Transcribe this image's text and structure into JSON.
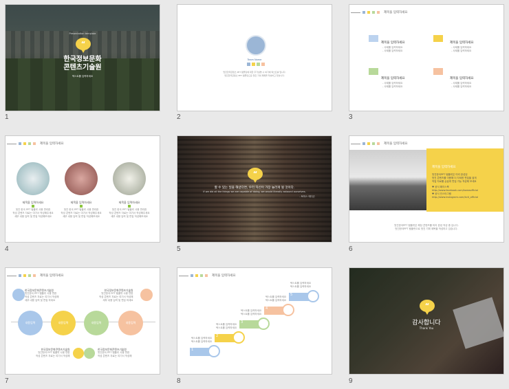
{
  "palette": {
    "yellow": "#f5d24a",
    "blue": "#a9c7ea",
    "green": "#b8d99a",
    "peach": "#f6c2a0",
    "gray": "#999999"
  },
  "slide_numbers": [
    "1",
    "2",
    "3",
    "4",
    "5",
    "6",
    "7",
    "8",
    "9"
  ],
  "common": {
    "header_title": "제목을 입력하세요",
    "quote_icon": "“"
  },
  "s1": {
    "small_title": "Presentation template",
    "title_line1": "한국정보문화",
    "title_line2": "콘텐츠기술원",
    "subtitle": "텍스트를 입력하세요"
  },
  "s2": {
    "team_name": "Team Name",
    "line1": "멋진한국콘텐츠 PPT 템플릿에 대한 추가설명 시 여기에 텍스트를 입니다.",
    "line2": "멋진한국콘텐츠 PPT 템플릿으로 멋진 기획 제목을 작성하고 있습니다."
  },
  "s3": {
    "items": [
      {
        "tag": "Point 01",
        "title": "제목을 입력하세요",
        "l1": "- 사례를 입력하세요",
        "l2": "- 사례를 입력하세요"
      },
      {
        "tag": "Point 02",
        "title": "제목을 입력하세요",
        "l1": "- 사례를 입력하세요",
        "l2": "- 사례를 입력하세요"
      },
      {
        "tag": "Point 03",
        "title": "제목을 입력하세요",
        "l1": "- 사례를 입력하세요",
        "l2": "- 사례를 입력하세요"
      },
      {
        "tag": "Point 04",
        "title": "제목을 입력하세요",
        "l1": "- 사례를 입력하세요",
        "l2": "- 사례를 입력하세요"
      }
    ]
  },
  "s4": {
    "items": [
      {
        "title": "제목을 입력하세요",
        "l1": "멋진 한국 PPT 템플릿 사용 편리한",
        "l2": "작성 콘텐츠 자료는 여기서 작성해주세요",
        "l3": "세부 내용 입력 및 편집 작성해보세요"
      },
      {
        "title": "제목을 입력하세요",
        "l1": "멋진 한국 PPT 템플릿 사용 편리한",
        "l2": "작성 콘텐츠 자료는 여기서 작성해주세요",
        "l3": "세부 내용 입력 및 편집 작성해보세요"
      },
      {
        "title": "제목을 입력하세요",
        "l1": "멋진 한국 PPT 템플릿 사용 편리한",
        "l2": "작성 콘텐츠 자료는 여기서 작성해주세요",
        "l3": "세부 내용 입력 및 편집 작성해보세요"
      }
    ]
  },
  "s5": {
    "quote_ko": "할 수 있는 일을 해낸다면, 우리 자신이 가장 놀라게 될 것이다.",
    "quote_en": "If we did all the things we are capable of doing, we would literally astound ourselves.",
    "author": "- 토마스 에디슨"
  },
  "s6": {
    "title": "제목을 입력하세요",
    "l1": "멋진한국PPT 템플릿은 미리 완성된",
    "l2": "멋진 콘텐츠를 이용해 더 자세한 편집을 쉽게",
    "l3": "작업 자료를 손쉽게 편집 가능 작성해 보세요",
    "fb_label": "♥ 공식 페이스북",
    "fb_url": "http://www.facebook.com/koreaofficial",
    "ig_label": "♥ 공식 인스타그램",
    "ig_url": "http://www.instagram.com/kcti_official",
    "bottom1": "멋진한국PPT 템플릿은 해당 콘텐츠를 미리 완성 작성 중 입니다.",
    "bottom2": "멋진한국PPT 템플릿으로 멋진 기획 제목을 작성하고 있습니다."
  },
  "s7": {
    "top_left": {
      "title": "한국정보문화콘텐츠기술원",
      "l1": "멋진한국 PPT 템플릿 사용 편한",
      "l2": "작성 콘텐츠 자료는 여기서 작성해",
      "l3": "세부 내용 입력 및 편집 하세요"
    },
    "top_right": {
      "title": "한국정보문화콘텐츠기술원",
      "l1": "멋진한국 PPT 템플릿 사용 편한",
      "l2": "작성 콘텐츠 자료는 여기서 작성해",
      "l3": "세부 내용 입력 및 편집 하세요"
    },
    "bottom_left": {
      "title": "한국정보문화콘텐츠기술원",
      "l1": "멋진한국 PPT 템플릿 사용 편한",
      "l2": "작성 콘텐츠 자료는 여기서 작성해"
    },
    "bottom_right": {
      "title": "한국정보문화콘텐츠기술원",
      "l1": "멋진한국 PPT 템플릿 사용 편한",
      "l2": "작성 콘텐츠 자료는 여기서 작성해"
    },
    "circles": [
      "내용입력",
      "내용입력",
      "내용입력",
      "내용입력"
    ]
  },
  "s8": {
    "steps": [
      {
        "num": "1",
        "l1": "텍스트를 입력하세요",
        "l2": "텍스트를 입력하세요"
      },
      {
        "num": "2",
        "l1": "텍스트를 입력하세요",
        "l2": "텍스트를 입력하세요"
      },
      {
        "num": "3",
        "l1": "텍스트를 입력하세요",
        "l2": "텍스트를 입력하세요"
      },
      {
        "num": "4",
        "l1": "텍스트를 입력하세요",
        "l2": "텍스트를 입력하세요"
      },
      {
        "num": "5",
        "l1": "텍스트를 입력하세요",
        "l2": "텍스트를 입력하세요"
      }
    ]
  },
  "s9": {
    "title": "감사합니다",
    "subtitle": "Thank You"
  }
}
